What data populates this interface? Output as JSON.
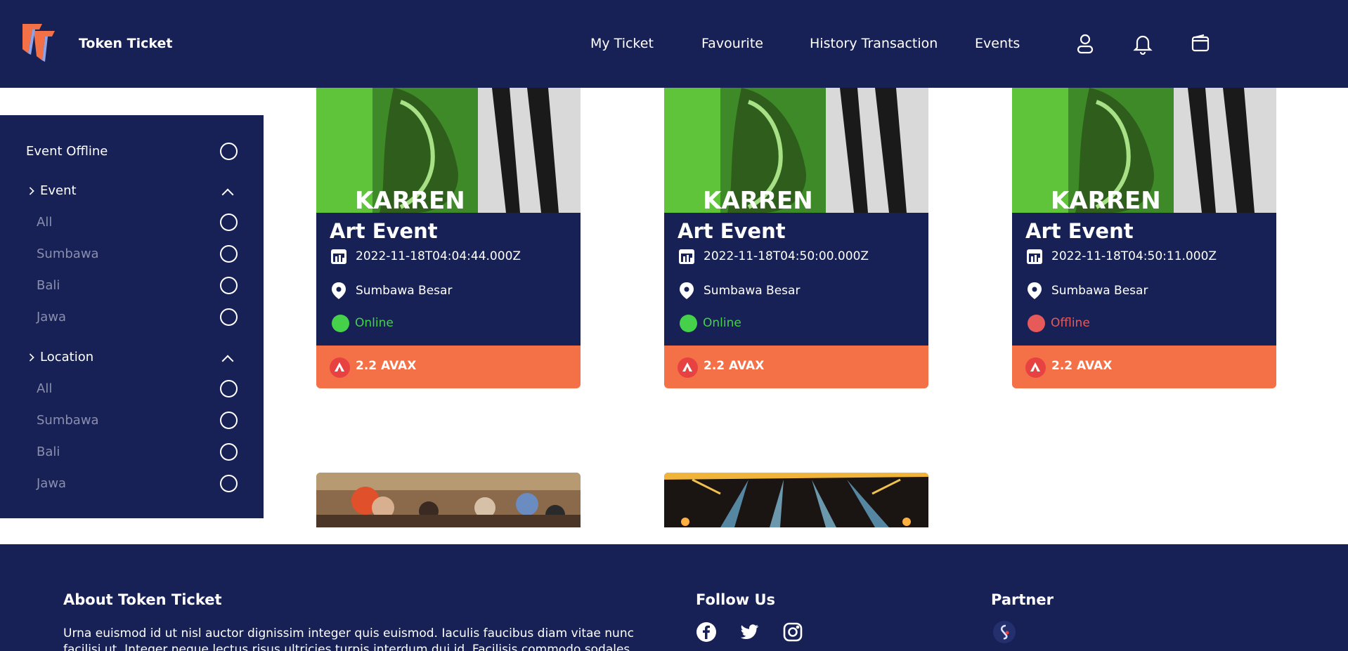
{
  "header": {
    "brand": "Token Ticket",
    "nav": [
      {
        "label": "My Ticket"
      },
      {
        "label": "Favourite"
      },
      {
        "label": "History Transaction"
      },
      {
        "label": "Events"
      }
    ],
    "icons": [
      "user-icon",
      "bell-icon",
      "wallet-icon"
    ]
  },
  "sidebar": {
    "event_offline": "Event Offline",
    "event_group": {
      "label": "Event",
      "options": [
        "All",
        "Sumbawa",
        "Bali",
        "Jawa"
      ]
    },
    "location_group": {
      "label": "Location",
      "options": [
        "All",
        "Sumbawa",
        "Bali",
        "Jawa"
      ]
    }
  },
  "cards": [
    {
      "title": "Art Event",
      "date": "2022-11-18T04:04:44.000Z",
      "location": "Sumbawa Besar",
      "status": "Online",
      "status_color": "#45d14a",
      "price": "2.2 AVAX",
      "poster_text": "KARREN"
    },
    {
      "title": "Art Event",
      "date": "2022-11-18T04:50:00.000Z",
      "location": "Sumbawa Besar",
      "status": "Online",
      "status_color": "#45d14a",
      "price": "2.2 AVAX",
      "poster_text": "KARREN"
    },
    {
      "title": "Art Event",
      "date": "2022-11-18T04:50:11.000Z",
      "location": "Sumbawa Besar",
      "status": "Offline",
      "status_color": "#e65a5a",
      "price": "2.2 AVAX",
      "poster_text": "KARREN"
    }
  ],
  "footer": {
    "about_title": "About Token Ticket",
    "about_text": "Urna euismod id ut nisl auctor dignissim integer quis euismod. Iaculis faucibus diam vitae nunc facilisi ut. Integer neque lectus risus ultricies turpis interdum dui id. Facilisis commodo sodales morbi tortor, tellus.",
    "follow_title": "Follow Us",
    "partner_title": "Partner",
    "social": [
      "facebook-icon",
      "twitter-icon",
      "instagram-icon"
    ]
  },
  "colors": {
    "navy": "#172155",
    "accent_orange": "#f47046",
    "online": "#45d14a",
    "offline": "#e65a5a"
  }
}
